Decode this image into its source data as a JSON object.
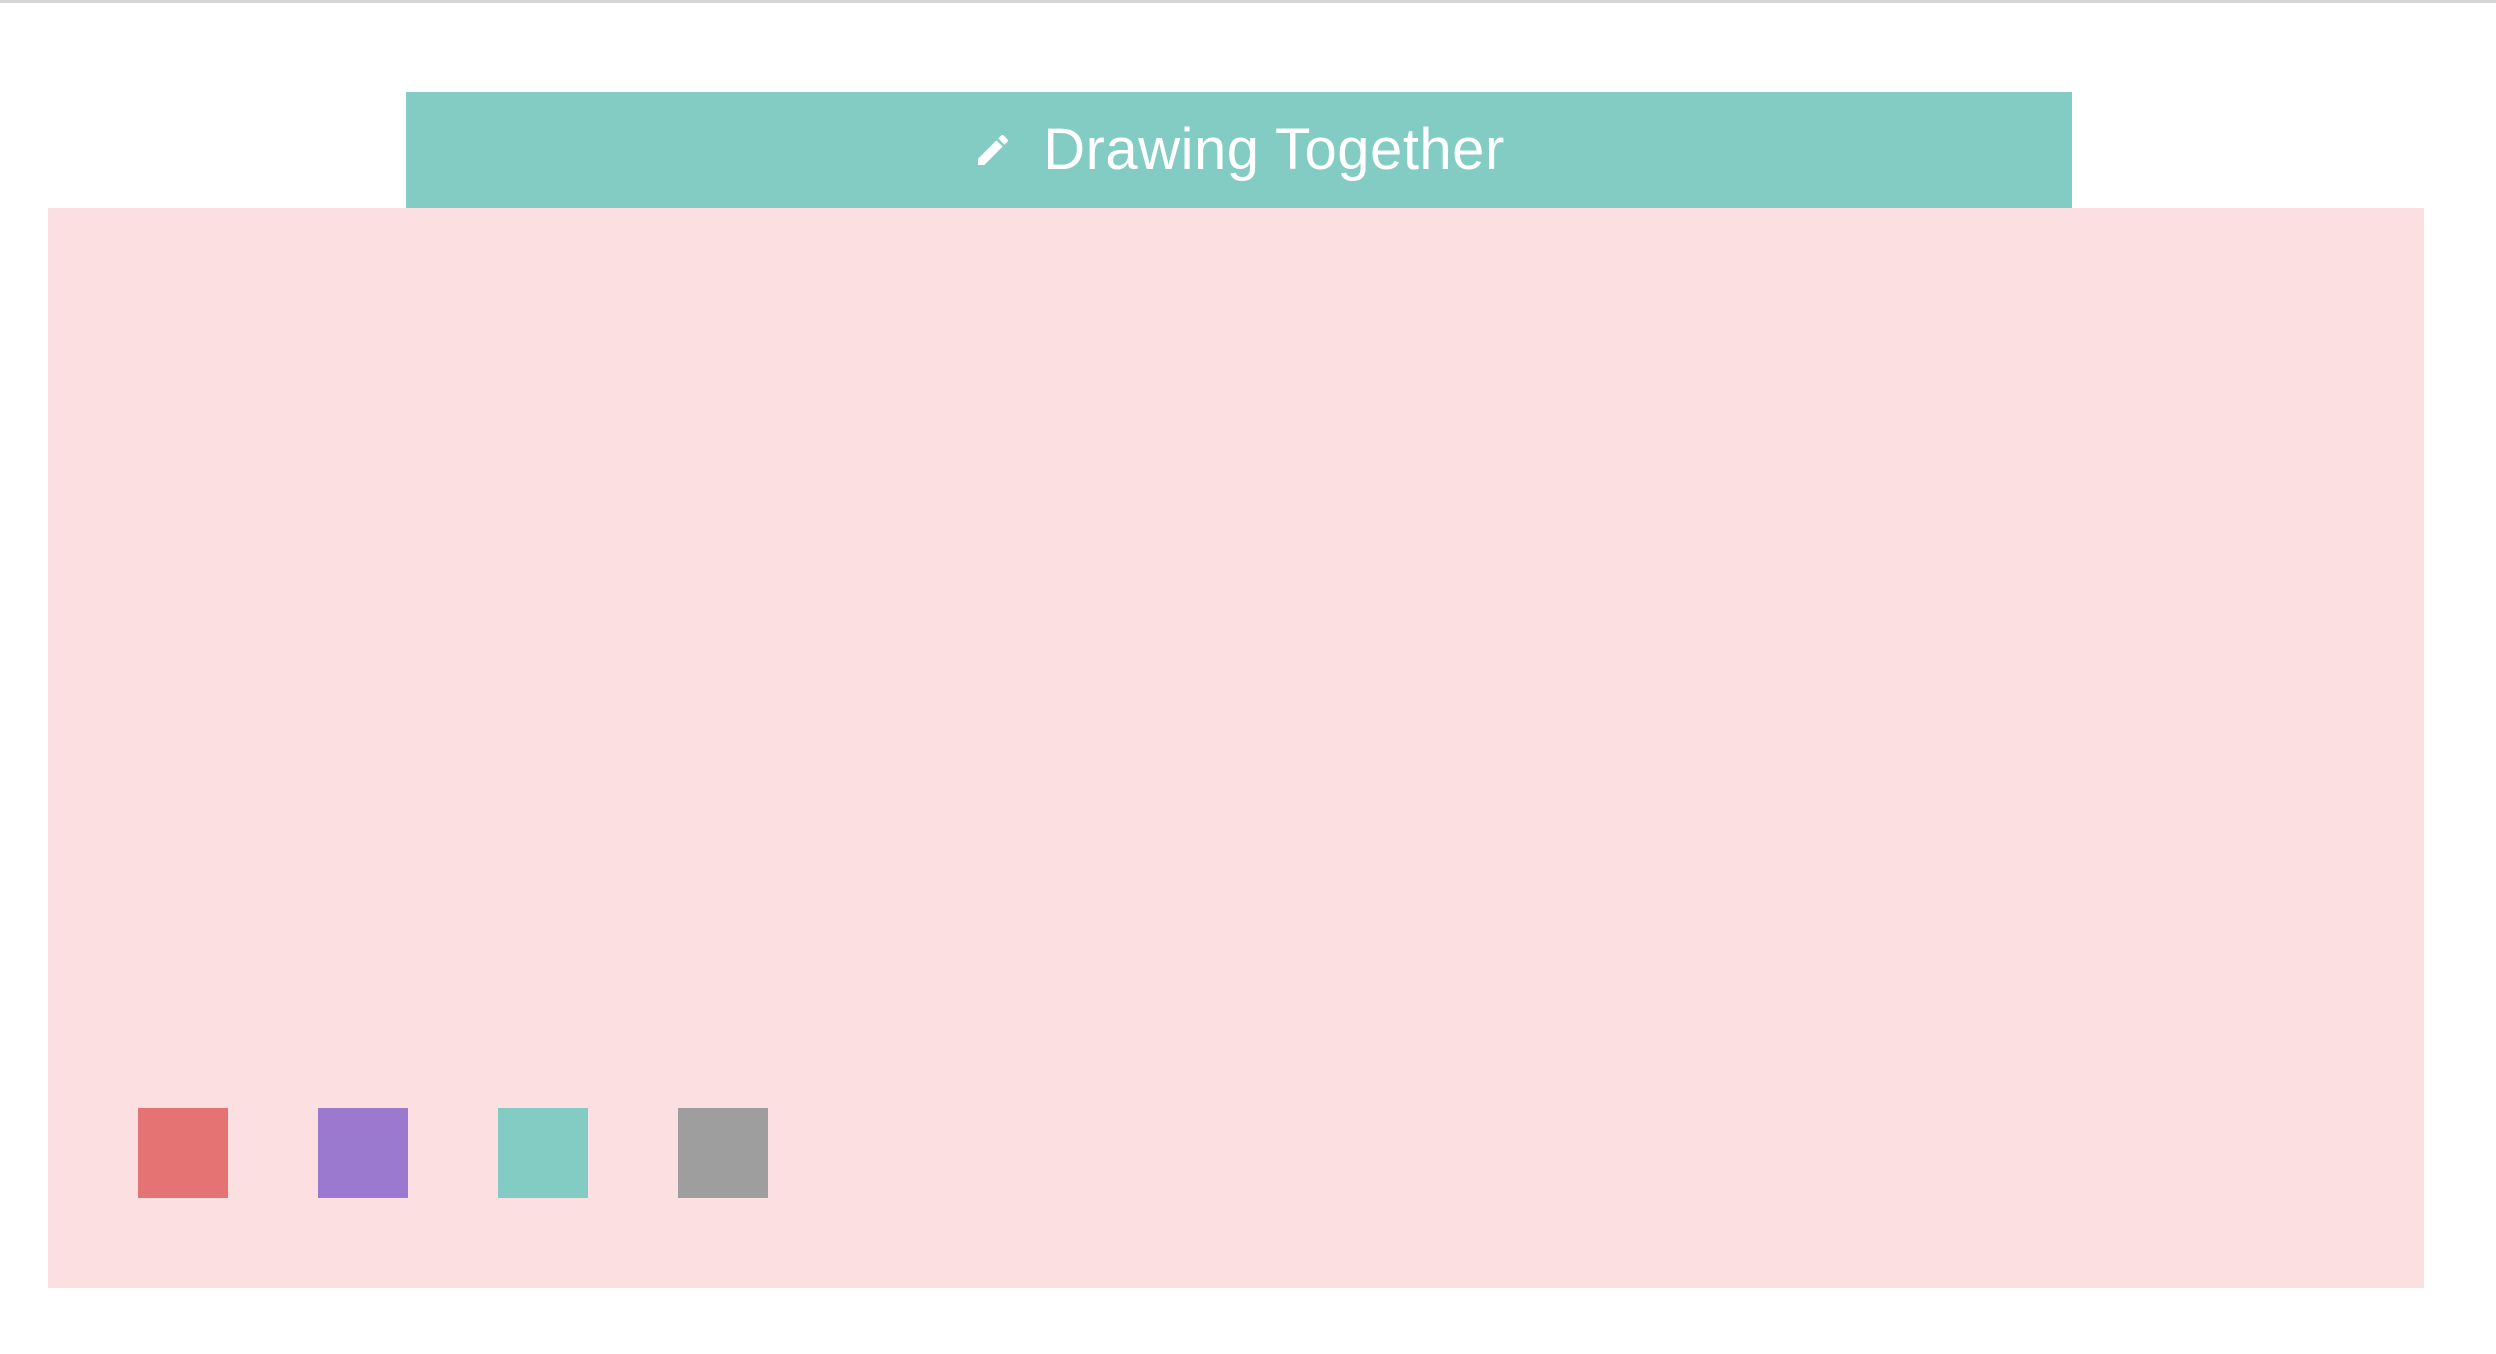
{
  "header": {
    "title": "Drawing Together",
    "icon": "pencil-icon",
    "background": "#83ccc3",
    "text_color": "#ffffff"
  },
  "canvas": {
    "background": "#fbdfe1"
  },
  "palette": {
    "colors": [
      {
        "name": "red",
        "hex": "#e57373"
      },
      {
        "name": "purple",
        "hex": "#9b79cf"
      },
      {
        "name": "teal",
        "hex": "#83ccc3"
      },
      {
        "name": "gray",
        "hex": "#9e9e9e"
      }
    ]
  }
}
